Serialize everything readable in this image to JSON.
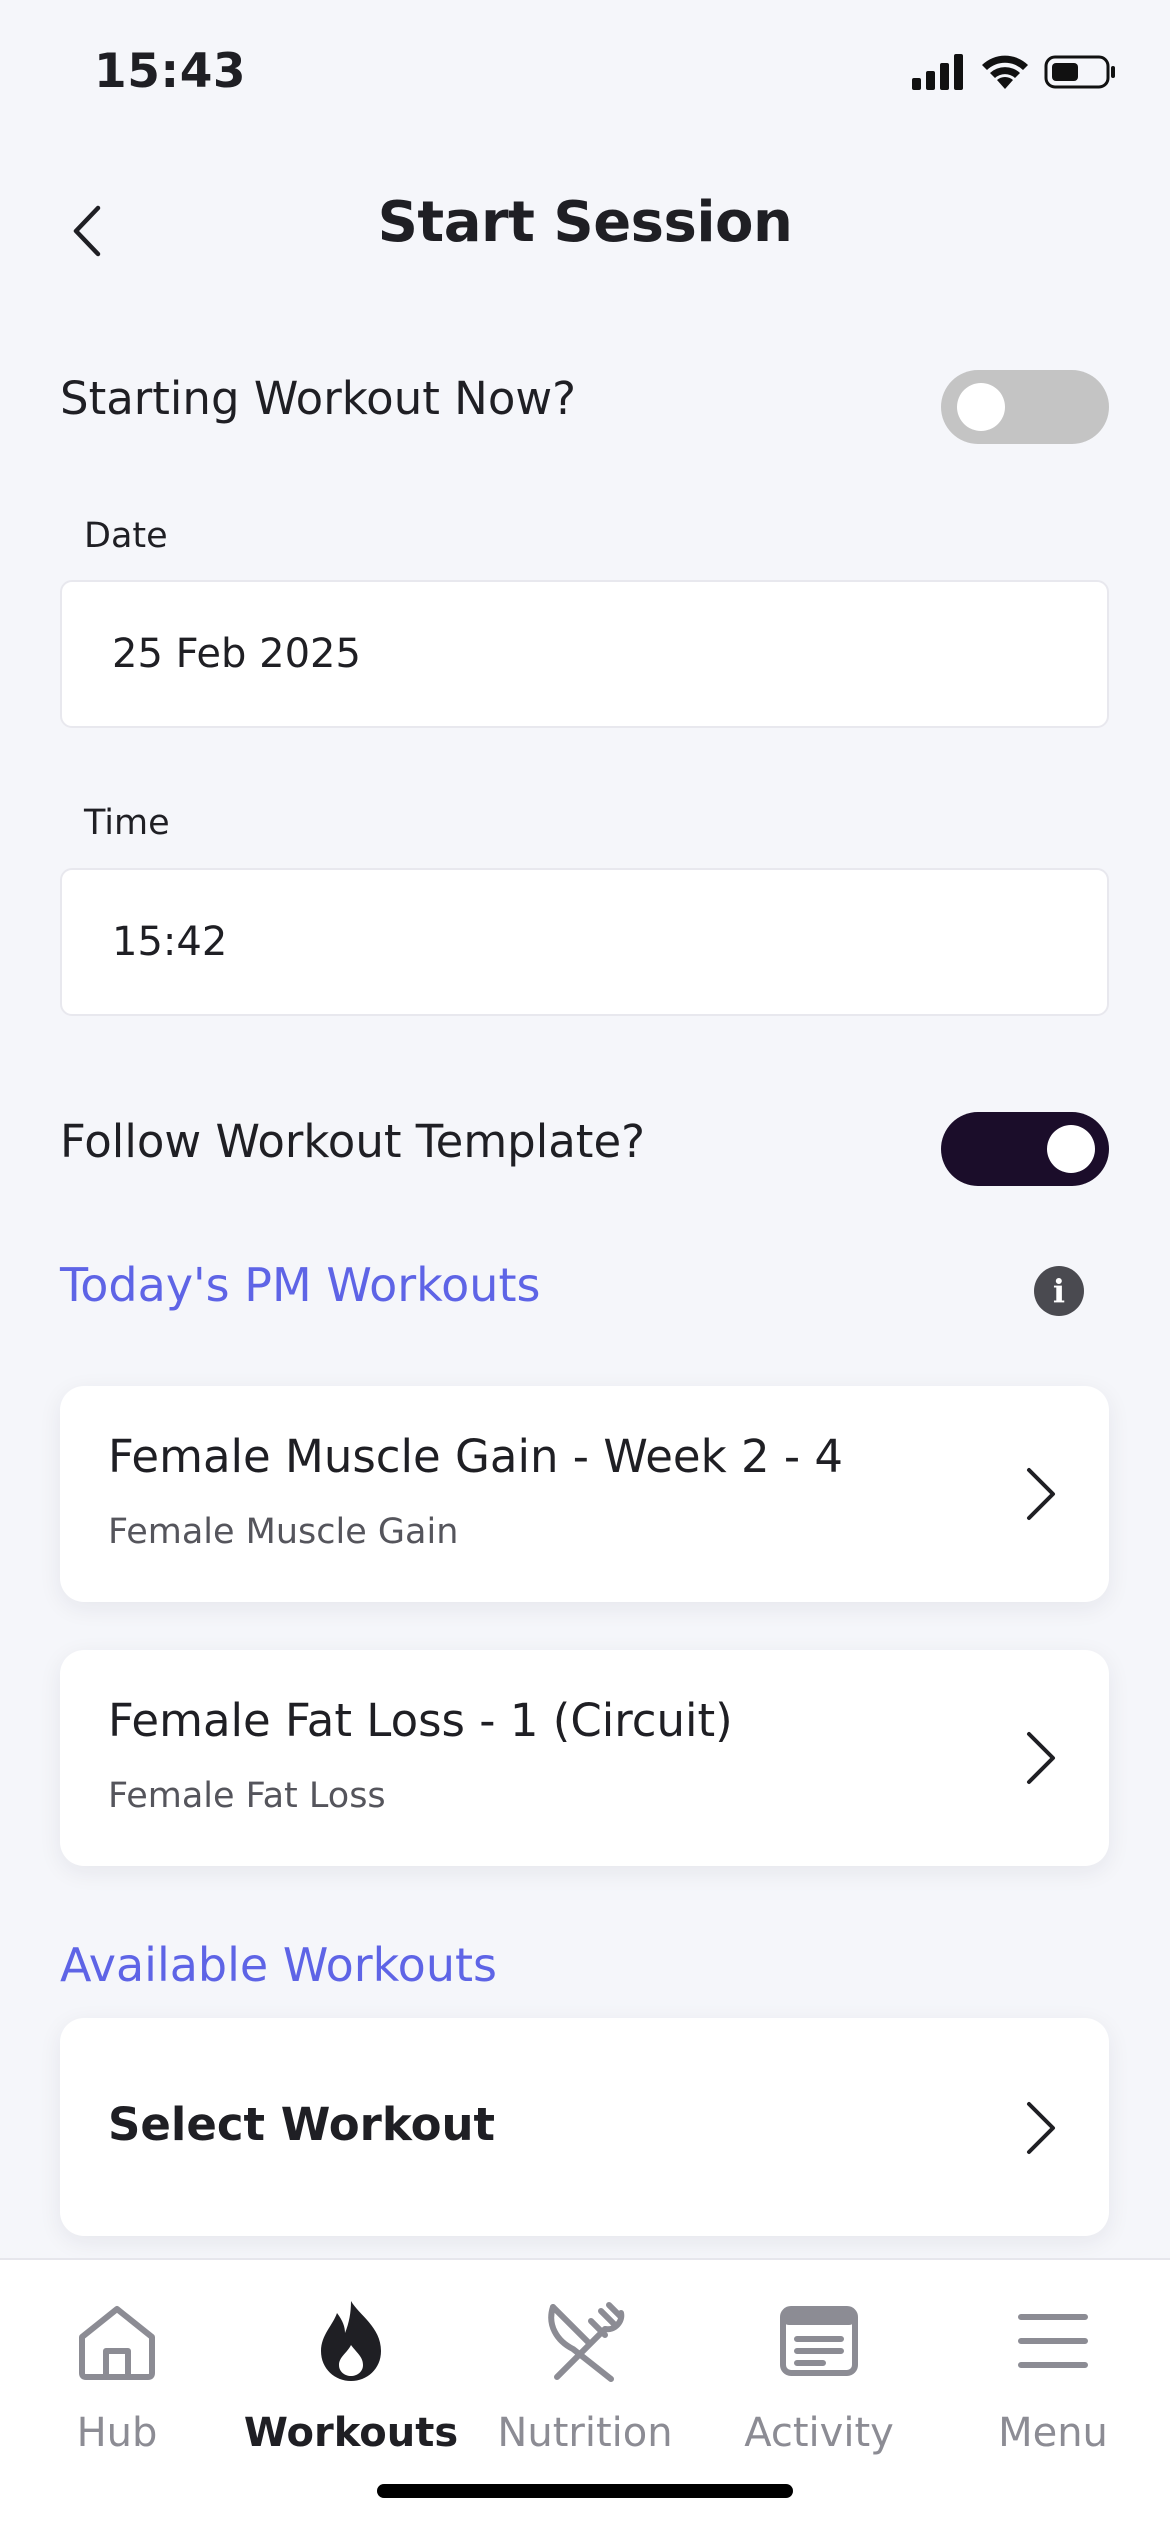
{
  "status_bar": {
    "time": "15:43",
    "icons": [
      "cellular-signal-icon",
      "wifi-icon",
      "battery-icon"
    ]
  },
  "header": {
    "title": "Start Session",
    "back_icon": "chevron-left-icon"
  },
  "starting_now": {
    "label": "Starting Workout Now?",
    "enabled": false
  },
  "date": {
    "label": "Date",
    "value": "25 Feb 2025"
  },
  "time": {
    "label": "Time",
    "value": "15:42"
  },
  "follow_template": {
    "label": "Follow Workout Template?",
    "enabled": true
  },
  "todays_workouts": {
    "title": "Today's PM Workouts",
    "info_icon": "info-icon",
    "items": [
      {
        "title": "Female Muscle Gain - Week 2 - 4",
        "subtitle": "Female Muscle Gain"
      },
      {
        "title": "Female Fat Loss - 1 (Circuit)",
        "subtitle": "Female Fat Loss"
      }
    ]
  },
  "available_workouts": {
    "title": "Available Workouts",
    "select_label": "Select Workout"
  },
  "tabbar": {
    "tabs": [
      {
        "label": "Hub",
        "icon": "home-icon",
        "active": false
      },
      {
        "label": "Workouts",
        "icon": "flame-icon",
        "active": true
      },
      {
        "label": "Nutrition",
        "icon": "fork-knife-icon",
        "active": false
      },
      {
        "label": "Activity",
        "icon": "newspaper-icon",
        "active": false
      },
      {
        "label": "Menu",
        "icon": "menu-icon",
        "active": false
      }
    ]
  },
  "colors": {
    "accent": "#5e64e6",
    "toggle_on": "#1b0d2a",
    "toggle_off": "#c4c4c4",
    "background": "#f5f6fa"
  }
}
